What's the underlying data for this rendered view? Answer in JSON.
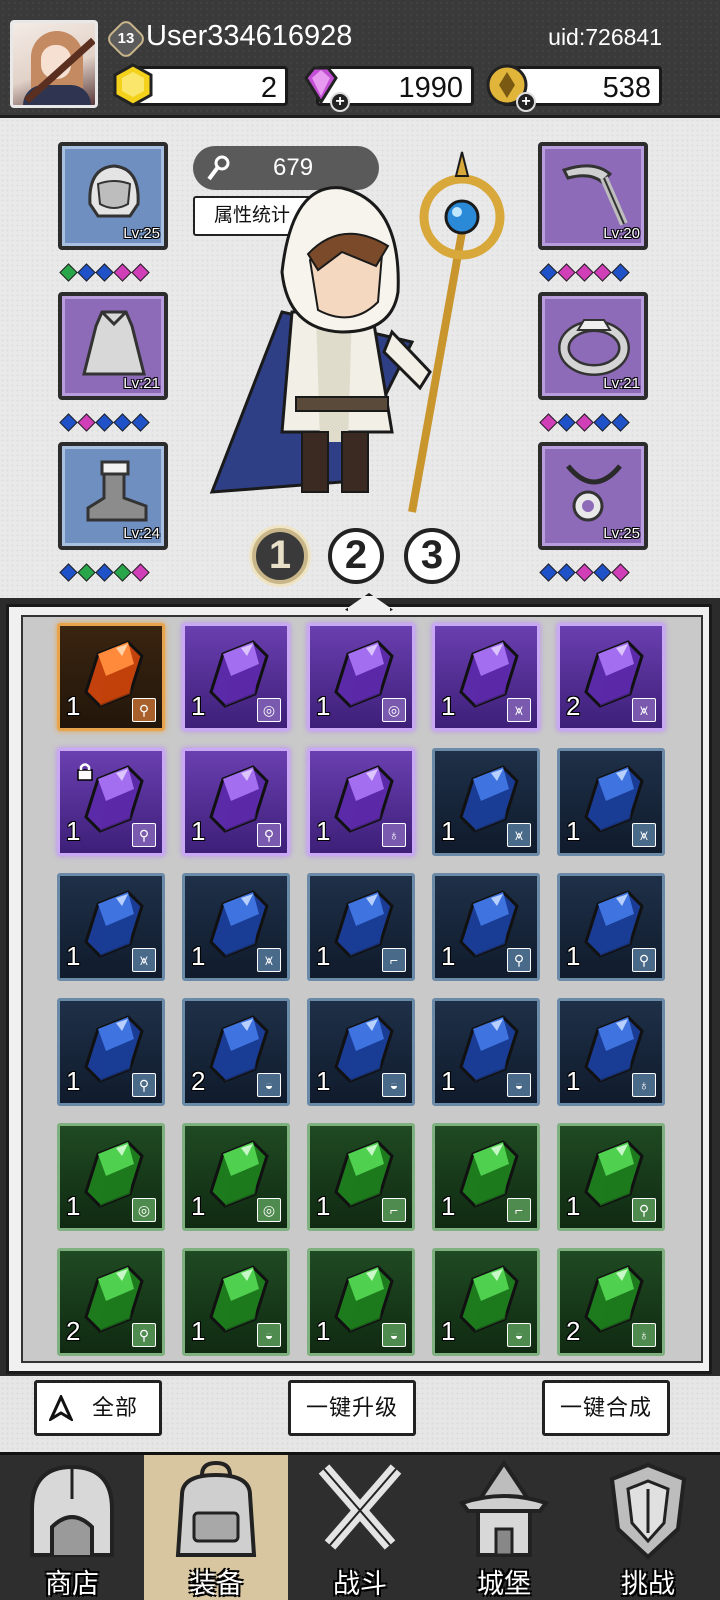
{
  "header": {
    "level": "13",
    "username": "User334616928",
    "uid": "uid:726841",
    "resources": [
      {
        "name": "gold-hexagon",
        "value": "2",
        "color": "#f4d21c"
      },
      {
        "name": "purple-diamond",
        "value": "1990",
        "color": "#c24fd4"
      },
      {
        "name": "gold-coin",
        "value": "538",
        "color": "#e0b53a"
      }
    ]
  },
  "hero": {
    "power": "679",
    "stats_button": "属性统计",
    "left_slots": [
      {
        "item": "helmet",
        "level": "Lv:25",
        "rarity": "blue"
      },
      {
        "item": "armor",
        "level": "Lv:21",
        "rarity": "purple"
      },
      {
        "item": "boots",
        "level": "Lv:24",
        "rarity": "blue"
      }
    ],
    "right_slots": [
      {
        "item": "weapon",
        "level": "Lv:20",
        "rarity": "purple"
      },
      {
        "item": "ring",
        "level": "Lv:21",
        "rarity": "purple"
      },
      {
        "item": "necklace",
        "level": "Lv:25",
        "rarity": "purple"
      }
    ],
    "pages": [
      "1",
      "2",
      "3"
    ],
    "active_page": "1"
  },
  "inventory": {
    "rows": [
      [
        {
          "r": "orange",
          "c": "1",
          "t": "weapon"
        },
        {
          "r": "purple",
          "c": "1",
          "t": "ring"
        },
        {
          "r": "purple",
          "c": "1",
          "t": "ring"
        },
        {
          "r": "purple",
          "c": "1",
          "t": "armor"
        },
        {
          "r": "purple",
          "c": "2",
          "t": "armor"
        }
      ],
      [
        {
          "r": "purple",
          "c": "1",
          "t": "weapon",
          "locked": true
        },
        {
          "r": "purple",
          "c": "1",
          "t": "weapon"
        },
        {
          "r": "purple",
          "c": "1",
          "t": "necklace"
        },
        {
          "r": "blue",
          "c": "1",
          "t": "armor"
        },
        {
          "r": "blue",
          "c": "1",
          "t": "armor"
        }
      ],
      [
        {
          "r": "blue",
          "c": "1",
          "t": "armor"
        },
        {
          "r": "blue",
          "c": "1",
          "t": "armor"
        },
        {
          "r": "blue",
          "c": "1",
          "t": "boots"
        },
        {
          "r": "blue",
          "c": "1",
          "t": "weapon"
        },
        {
          "r": "blue",
          "c": "1",
          "t": "weapon"
        }
      ],
      [
        {
          "r": "blue",
          "c": "1",
          "t": "weapon"
        },
        {
          "r": "blue",
          "c": "2",
          "t": "helmet"
        },
        {
          "r": "blue",
          "c": "1",
          "t": "helmet"
        },
        {
          "r": "blue",
          "c": "1",
          "t": "helmet"
        },
        {
          "r": "blue",
          "c": "1",
          "t": "necklace"
        }
      ],
      [
        {
          "r": "green",
          "c": "1",
          "t": "ring"
        },
        {
          "r": "green",
          "c": "1",
          "t": "ring"
        },
        {
          "r": "green",
          "c": "1",
          "t": "boots"
        },
        {
          "r": "green",
          "c": "1",
          "t": "boots"
        },
        {
          "r": "green",
          "c": "1",
          "t": "weapon"
        }
      ],
      [
        {
          "r": "green",
          "c": "2",
          "t": "weapon"
        },
        {
          "r": "green",
          "c": "1",
          "t": "helmet"
        },
        {
          "r": "green",
          "c": "1",
          "t": "helmet"
        },
        {
          "r": "green",
          "c": "1",
          "t": "helmet"
        },
        {
          "r": "green",
          "c": "2",
          "t": "necklace"
        }
      ]
    ]
  },
  "actions": {
    "filter_all": "全部",
    "upgrade_all": "一键升级",
    "merge_all": "一键合成"
  },
  "nav": [
    {
      "label": "商店",
      "icon": "shop-icon",
      "active": false
    },
    {
      "label": "装备",
      "icon": "backpack-icon",
      "active": true
    },
    {
      "label": "战斗",
      "icon": "crossed-swords-icon",
      "active": false
    },
    {
      "label": "城堡",
      "icon": "castle-icon",
      "active": false
    },
    {
      "label": "挑战",
      "icon": "challenge-crest-icon",
      "active": false
    }
  ]
}
